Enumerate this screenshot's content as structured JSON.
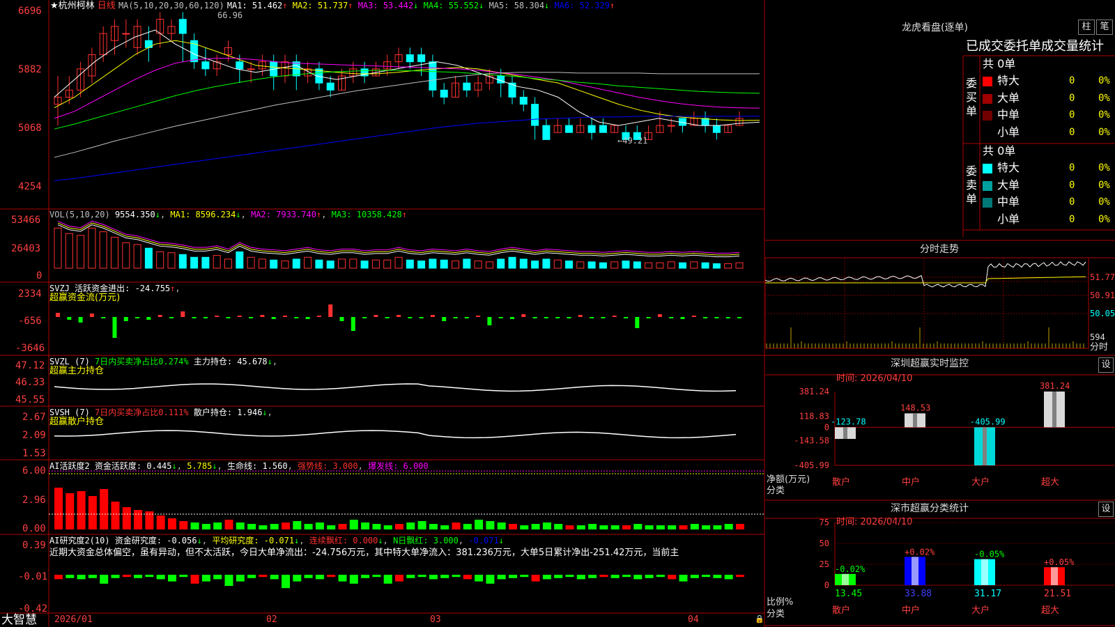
{
  "header": {
    "stock_name": "★杭州柯林",
    "period": "日线",
    "ma_title": "MA(5,10,20,30,60,120)",
    "ma_values": [
      {
        "label": "MA1: 51.462",
        "arrow": "↑",
        "color": "#ffffff"
      },
      {
        "label": "MA2: 51.737",
        "arrow": "↑",
        "color": "#ffff00"
      },
      {
        "label": "MA3: 53.442",
        "arrow": "↓",
        "color": "#ff00ff"
      },
      {
        "label": "MA4: 55.552",
        "arrow": "↓",
        "color": "#00ff00"
      },
      {
        "label": "MA5: 58.304",
        "arrow": "↓",
        "color": "#c0c0c0"
      },
      {
        "label": "MA6: 52.329",
        "arrow": "↑",
        "color": "#0000ff"
      }
    ],
    "high_marker": "66.96",
    "low_marker": "←49.21"
  },
  "price_axis": [
    "6696",
    "5882",
    "5068",
    "4254"
  ],
  "volume": {
    "title": "VOL(5,10,20)",
    "value": "9554.350",
    "ma1": "MA1: 8596.234",
    "ma2": "MA2: 7933.740",
    "ma3": "MA3: 10358.428",
    "axis": [
      "53466",
      "26403",
      "0"
    ]
  },
  "svzj": {
    "line1": "SVZJ  活跃资金进出: -24.755",
    "line2": "超赢资金流(万元)",
    "axis": [
      "2334",
      "-656",
      "-3646"
    ]
  },
  "svzl": {
    "name": "SVZL (7)",
    "desc": "7日内买卖净占比0.274%",
    "hold": "主力持仓: 45.678",
    "line2": "超赢主力持仓",
    "axis": [
      "47.12",
      "46.33",
      "45.55"
    ]
  },
  "svsh": {
    "name": "SVSH (7)",
    "desc": "7日内买卖净占比0.111%",
    "hold": "散户持仓: 1.946",
    "line2": "超赢散户持仓",
    "axis": [
      "2.67",
      "2.09",
      "1.53"
    ]
  },
  "ai_active": {
    "name": "AI活跃度2",
    "a": "资金活跃度: 0.445",
    "b": "5.785",
    "c": "生命线: 1.560",
    "d": "强势线: 3.000",
    "e": "爆发线: 6.000",
    "axis": [
      "6.00",
      "2.96",
      "0.00"
    ]
  },
  "ai_research": {
    "name": "AI研究度2(10)",
    "a": "资金研究度: -0.056",
    "b": "平均研究度: -0.071",
    "c": "连续飘红: 0.000",
    "d": "N日飘红: 3.000",
    "e": "-0.071",
    "comment": "近期大资金总体偏空，虽有异动，但不太活跃，今日大单净流出：-24.756万元，其中特大单净流入：381.236万元，大单5日累计净出-251.42万元，当前主",
    "axis": [
      "0.39",
      "-0.01",
      "-0.42"
    ]
  },
  "date_axis": [
    "2026/01",
    "02",
    "03",
    "04"
  ],
  "logo": "大智慧",
  "right": {
    "longhu_title": "龙虎看盘(逐单)",
    "tabs": [
      "柱",
      "笔"
    ],
    "table_title": "已成交委托单成交量统计",
    "buy_label": [
      "委",
      "买",
      "单"
    ],
    "sell_label": [
      "委",
      "卖",
      "单"
    ],
    "buy_total": "共 0单",
    "sell_total": "共 0单",
    "buy_rows": [
      {
        "name": "特大",
        "count": "0",
        "pct": "0%",
        "color": "#ff0000"
      },
      {
        "name": "大单",
        "count": "0",
        "pct": "0%",
        "color": "#a00000"
      },
      {
        "name": "中单",
        "count": "0",
        "pct": "0%",
        "color": "#700000"
      },
      {
        "name": "小单",
        "count": "0",
        "pct": "0%",
        "color": ""
      }
    ],
    "sell_rows": [
      {
        "name": "特大",
        "count": "0",
        "pct": "0%",
        "color": "#00ffff"
      },
      {
        "name": "大单",
        "count": "0",
        "pct": "0%",
        "color": "#00a0a0"
      },
      {
        "name": "中单",
        "count": "0",
        "pct": "0%",
        "color": "#007878"
      },
      {
        "name": "小单",
        "count": "0",
        "pct": "0%",
        "color": ""
      }
    ],
    "intraday_title": "分时走势",
    "intraday_axis": [
      "51.77",
      "50.91",
      "50.05",
      "594",
      "分时"
    ],
    "sz_title": "深圳超赢实时监控",
    "sz_settings": "设",
    "sz_time": "时间: 2026/04/10",
    "sz_axis": [
      "381.24",
      "118.83",
      "0",
      "-143.58",
      "-405.99"
    ],
    "sz_net_label": "净额(万元)",
    "sz_cat_label": "分类",
    "sz_bars": [
      {
        "cat": "散户",
        "value": -123.78,
        "label": "-123.78",
        "color": "#ffffff"
      },
      {
        "cat": "中户",
        "value": 148.53,
        "label": "148.53",
        "color": "#ffffff"
      },
      {
        "cat": "大户",
        "value": -405.99,
        "label": "-405.99",
        "color": "#00ffff"
      },
      {
        "cat": "超大",
        "value": 381.24,
        "label": "381.24",
        "color": "#ffffff"
      }
    ],
    "cls_title": "深市超赢分类统计",
    "cls_settings": "设",
    "cls_time": "时间: 2026/04/10",
    "cls_axis": [
      "75",
      "50",
      "25",
      "0"
    ],
    "cls_ratio_label": "比例%",
    "cls_cat_label": "分类",
    "cls_bars": [
      {
        "cat": "散户",
        "value": 13.45,
        "label": "13.45",
        "change": "-0.02%",
        "color": "#00ff00"
      },
      {
        "cat": "中户",
        "value": 33.88,
        "label": "33.88",
        "change": "+0.02%",
        "color": "#0000ff"
      },
      {
        "cat": "大户",
        "value": 31.17,
        "label": "31.17",
        "change": "-0.05%",
        "color": "#00ffff"
      },
      {
        "cat": "超大",
        "value": 21.51,
        "label": "21.51",
        "change": "+0.05%",
        "color": "#ff0000"
      }
    ]
  },
  "chart_data": [
    {
      "type": "bar",
      "title": "深圳超赢实时监控",
      "ylabel": "净额(万元)",
      "xlabel": "分类",
      "categories": [
        "散户",
        "中户",
        "大户",
        "超大"
      ],
      "values": [
        -123.78,
        148.53,
        -405.99,
        381.24
      ],
      "ylim": [
        -405.99,
        381.24
      ]
    },
    {
      "type": "bar",
      "title": "深市超赢分类统计",
      "ylabel": "比例%",
      "xlabel": "分类",
      "categories": [
        "散户",
        "中户",
        "大户",
        "超大"
      ],
      "values": [
        13.45,
        33.88,
        31.17,
        21.51
      ],
      "ylim": [
        0,
        75
      ]
    },
    {
      "type": "line",
      "title": "杭州柯林 日线",
      "ylabel": "",
      "ylim": [
        42.54,
        66.96
      ],
      "series": [
        {
          "name": "MA1",
          "values": [
            55.0,
            57.5,
            60.0,
            62.0,
            63.5,
            64.5,
            62.5,
            61.0,
            60.0,
            59.0,
            58.5,
            59.0,
            59.5,
            58.0,
            57.5,
            58.0,
            58.5,
            59.0,
            59.5,
            60.0,
            59.5,
            58.5,
            57.5,
            56.5,
            56.0,
            55.0,
            53.0,
            51.5,
            51.0,
            51.5,
            52.0,
            51.5,
            51.0,
            51.0,
            51.3,
            51.462
          ]
        },
        {
          "name": "MA2",
          "values": [
            53.5,
            55.0,
            57.0,
            59.0,
            61.0,
            62.5,
            63.0,
            62.5,
            61.5,
            60.5,
            59.5,
            59.2,
            59.0,
            58.8,
            58.5,
            58.3,
            58.3,
            58.5,
            58.8,
            59.0,
            59.2,
            59.0,
            58.5,
            58.0,
            57.5,
            57.0,
            56.0,
            55.0,
            54.0,
            53.2,
            52.6,
            52.2,
            52.0,
            51.8,
            51.7,
            51.737
          ]
        },
        {
          "name": "MA3",
          "values": [
            52.0,
            53.0,
            54.5,
            56.0,
            57.5,
            58.8,
            59.8,
            60.3,
            60.5,
            60.5,
            60.3,
            60.0,
            59.8,
            59.7,
            59.6,
            59.5,
            59.4,
            59.3,
            59.2,
            59.1,
            59.0,
            58.8,
            58.5,
            58.2,
            57.8,
            57.4,
            56.8,
            56.2,
            55.6,
            55.0,
            54.5,
            54.1,
            53.8,
            53.6,
            53.5,
            53.442
          ]
        },
        {
          "name": "MA4",
          "values": [
            50.5,
            51.2,
            52.0,
            52.8,
            53.6,
            54.4,
            55.2,
            55.9,
            56.5,
            57.0,
            57.5,
            57.9,
            58.2,
            58.4,
            58.6,
            58.7,
            58.8,
            58.8,
            58.7,
            58.6,
            58.5,
            58.3,
            58.1,
            57.9,
            57.6,
            57.4,
            57.1,
            56.9,
            56.6,
            56.4,
            56.2,
            56.0,
            55.8,
            55.7,
            55.6,
            55.552
          ]
        },
        {
          "name": "MA5",
          "values": [
            46.5,
            47.2,
            48.0,
            48.8,
            49.5,
            50.2,
            50.9,
            51.5,
            52.1,
            52.7,
            53.3,
            53.9,
            54.4,
            54.9,
            55.4,
            55.9,
            56.3,
            56.7,
            57.1,
            57.5,
            57.9,
            58.2,
            58.4,
            58.5,
            58.5,
            58.5,
            58.4,
            58.4,
            58.4,
            58.4,
            58.3,
            58.3,
            58.3,
            58.3,
            58.3,
            58.304
          ]
        },
        {
          "name": "MA6",
          "values": [
            43.2,
            43.5,
            43.9,
            44.3,
            44.7,
            45.1,
            45.5,
            45.9,
            46.3,
            46.7,
            47.1,
            47.5,
            47.9,
            48.3,
            48.7,
            49.1,
            49.5,
            49.9,
            50.3,
            50.7,
            51.0,
            51.3,
            51.5,
            51.7,
            51.9,
            52.0,
            52.1,
            52.2,
            52.2,
            52.3,
            52.3,
            52.3,
            52.3,
            52.3,
            52.3,
            52.329
          ]
        }
      ]
    }
  ]
}
